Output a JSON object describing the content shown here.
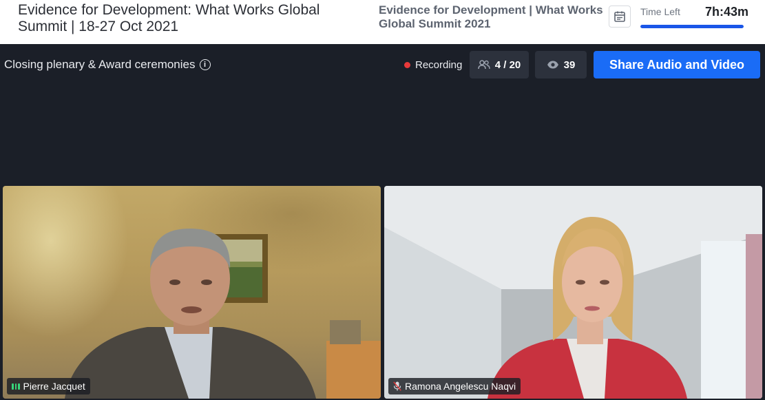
{
  "header": {
    "event_title": "Evidence for Development: What Works Global Summit | 18-27 Oct 2021",
    "summit_name": "Evidence for Development | What Works Global Summit 2021",
    "calendar_icon": "calendar-icon",
    "time_left_label": "Time Left",
    "time_left_value": "7h:43m",
    "time_progress": 1.0
  },
  "session": {
    "title": "Closing plenary & Award ceremonies",
    "info_icon": "info-icon",
    "recording_label": "Recording",
    "participants": "4 / 20",
    "viewers": "39",
    "share_button": "Share Audio and Video"
  },
  "tiles": [
    {
      "name": "Pierre Jacquet",
      "status_icon": "audio-active-icon"
    },
    {
      "name": "Ramona Angelescu Naqvi",
      "status_icon": "mic-muted-icon"
    }
  ],
  "colors": {
    "accent": "#1a6cf6",
    "recording": "#e8393a",
    "speaking": "#37d67a",
    "background": "#1b1f28"
  }
}
